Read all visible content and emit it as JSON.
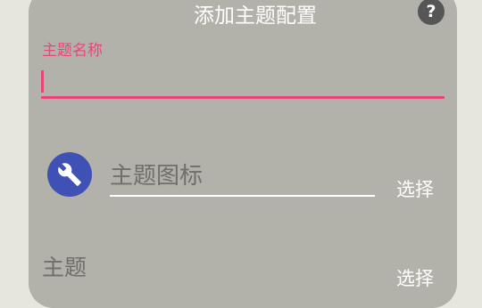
{
  "dialog": {
    "title": "添加主题配置",
    "help_icon": "question-mark-icon",
    "help_label": "?"
  },
  "name_field": {
    "label": "主题名称",
    "value": "",
    "accent_color": "#e8457a"
  },
  "icon_field": {
    "icon": "wrench-icon",
    "icon_bg_color": "#3f51b5",
    "placeholder": "主题图标",
    "select_label": "选择"
  },
  "theme_field": {
    "label": "主题",
    "select_label": "选择"
  }
}
